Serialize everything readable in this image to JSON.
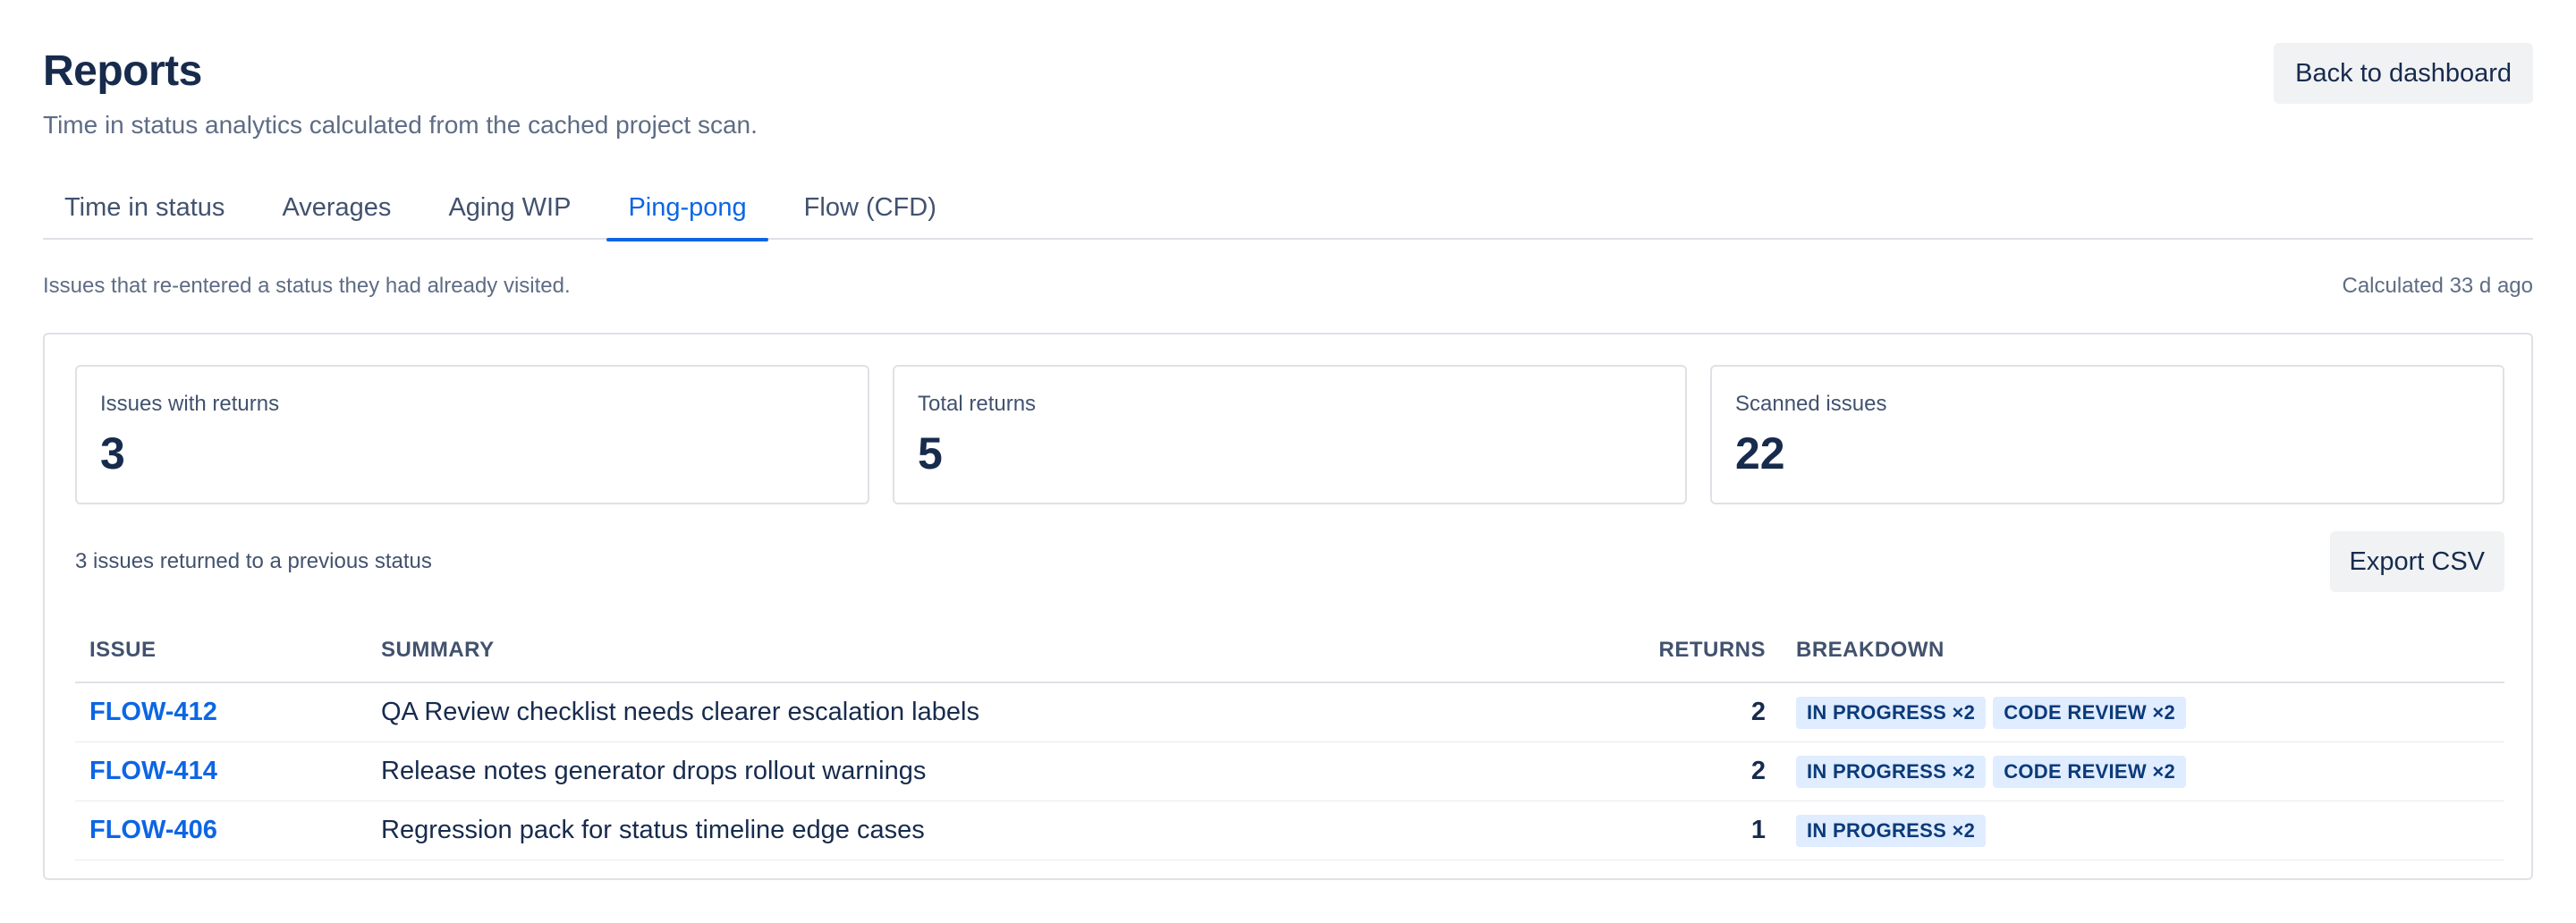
{
  "header": {
    "title": "Reports",
    "subtitle": "Time in status analytics calculated from the cached project scan.",
    "back_label": "Back to dashboard"
  },
  "tabs": [
    {
      "label": "Time in status",
      "active": false
    },
    {
      "label": "Averages",
      "active": false
    },
    {
      "label": "Aging WIP",
      "active": false
    },
    {
      "label": "Ping-pong",
      "active": true
    },
    {
      "label": "Flow (CFD)",
      "active": false
    }
  ],
  "info": {
    "description": "Issues that re-entered a status they had already visited.",
    "calculated": "Calculated 33 d ago"
  },
  "stats": [
    {
      "label": "Issues with returns",
      "value": "3"
    },
    {
      "label": "Total returns",
      "value": "5"
    },
    {
      "label": "Scanned issues",
      "value": "22"
    }
  ],
  "list": {
    "count_text": "3 issues returned to a previous status",
    "export_label": "Export CSV"
  },
  "table": {
    "headers": {
      "issue": "ISSUE",
      "summary": "SUMMARY",
      "returns": "RETURNS",
      "breakdown": "BREAKDOWN"
    },
    "rows": [
      {
        "issue": "FLOW-412",
        "summary": "QA Review checklist needs clearer escalation labels",
        "returns": "2",
        "breakdown": [
          "IN PROGRESS ×2",
          "CODE REVIEW ×2"
        ]
      },
      {
        "issue": "FLOW-414",
        "summary": "Release notes generator drops rollout warnings",
        "returns": "2",
        "breakdown": [
          "IN PROGRESS ×2",
          "CODE REVIEW ×2"
        ]
      },
      {
        "issue": "FLOW-406",
        "summary": "Regression pack for status timeline edge cases",
        "returns": "1",
        "breakdown": [
          "IN PROGRESS ×2"
        ]
      }
    ]
  },
  "colors": {
    "accent": "#0c66e4",
    "chip_bg": "#e0ecff",
    "text": "#172b4d",
    "muted": "#5e6c84",
    "border": "#dfe1e6"
  }
}
